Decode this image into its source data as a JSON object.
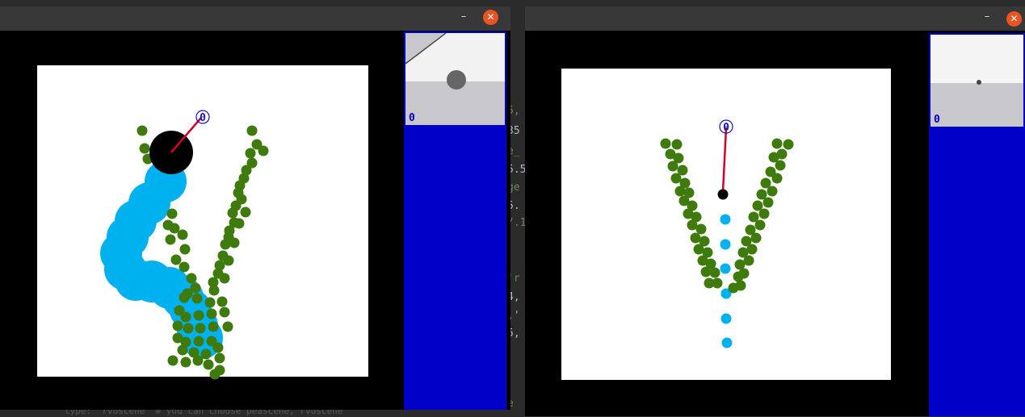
{
  "background_editor": {
    "code_fragments": [
      "5,",
      "35",
      "e_",
      "5.5",
      "ge",
      "5.",
      "/.1",
      "'r",
      "4,",
      ",'",
      "5,",
      "e"
    ],
    "bottom_line": "type: 'rvoscene' # you can choose peascene, rvoscene"
  },
  "window_left": {
    "minimize_label": "–",
    "close_label": "✕",
    "camera_label": "0",
    "agent_label": "0"
  },
  "window_right": {
    "minimize_label": "–",
    "close_label": "✕",
    "camera_label": "0",
    "agent_label": "0"
  },
  "colors": {
    "obstacle_green": "#3e7a0c",
    "trail_cyan": "#00b1f0",
    "agent_black": "#000000",
    "heading_red": "#d4002a",
    "goal_blue": "#1010c0",
    "side_panel_blue": "#0000c8",
    "close_button": "#e95420",
    "titlebar": "#383838"
  }
}
